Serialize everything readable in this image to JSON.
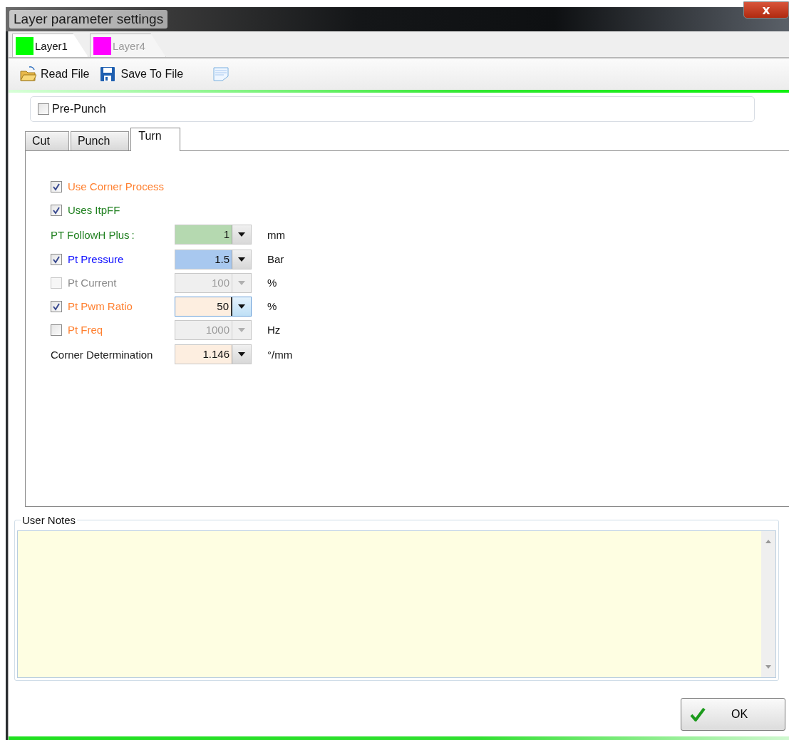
{
  "window": {
    "title": "Layer parameter settings",
    "close": "x"
  },
  "layer_tabs": [
    {
      "label": "Layer1",
      "color": "#00ff00",
      "selected": true
    },
    {
      "label": "Layer4",
      "color": "#ff00ff",
      "selected": false
    }
  ],
  "toolbar": [
    {
      "kind": "open",
      "label": "Read File"
    },
    {
      "kind": "save",
      "label": "Save To File"
    },
    {
      "kind": "notes"
    }
  ],
  "pre_punch": {
    "label": "Pre-Punch",
    "checked": false
  },
  "tabs": [
    {
      "label": "Cut",
      "selected": false
    },
    {
      "label": "Punch",
      "selected": false
    },
    {
      "label": "Turn",
      "selected": true
    }
  ],
  "rows": [
    {
      "kind": "check",
      "label": "Use Corner Process",
      "color": "#ff8030",
      "checked": true,
      "disabled": false
    },
    {
      "kind": "check",
      "label": "Uses ItpFF",
      "color": "#208020",
      "checked": true,
      "disabled": false
    },
    {
      "kind": "field",
      "label": "PT FollowH Plus :",
      "color": "#208020",
      "field": {
        "value": "1",
        "color": "#b5d9b0",
        "disabled": false,
        "focused": false
      },
      "unit": "mm"
    },
    {
      "kind": "check",
      "label": "Pt Pressure",
      "color": "#1010ff",
      "checked": true,
      "disabled": false,
      "field": {
        "value": "1.5",
        "color": "#a8c8ef",
        "disabled": false,
        "focused": false
      },
      "unit": "Bar"
    },
    {
      "kind": "check",
      "label": "Pt Current",
      "color": "#8a8a8a",
      "checked": false,
      "disabled": true,
      "field": {
        "value": "100",
        "color": "#efefef",
        "disabled": true,
        "focused": false
      },
      "unit": "%"
    },
    {
      "kind": "check",
      "label": "Pt Pwm Ratio",
      "color": "#ff8030",
      "checked": true,
      "disabled": false,
      "field": {
        "value": "50",
        "color": "#fdeee0",
        "disabled": false,
        "focused": true
      },
      "unit": "%"
    },
    {
      "kind": "check",
      "label": "Pt Freq",
      "color": "#ff8030",
      "checked": false,
      "disabled": false,
      "field": {
        "value": "1000",
        "color": "#efefef",
        "disabled": true,
        "focused": false
      },
      "unit": "Hz"
    },
    {
      "kind": "field",
      "label": "Corner Determination",
      "color": "#202020",
      "field": {
        "value": "1.146",
        "color": "#fdeee0",
        "disabled": false,
        "focused": false
      },
      "unit": "°/mm"
    }
  ],
  "user_notes": {
    "label": "User Notes"
  },
  "ok_button": {
    "label": "OK"
  }
}
